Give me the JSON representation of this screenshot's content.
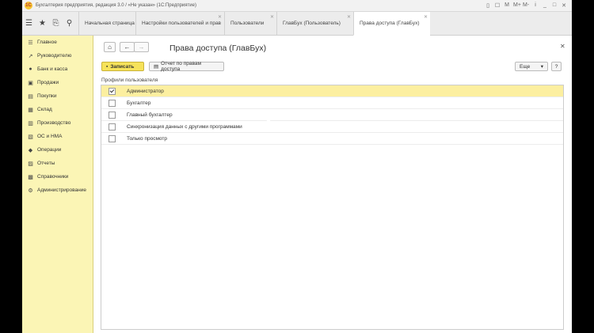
{
  "window": {
    "title": "Бухгалтерия предприятия, редакция 3.0 / «Не указан» (1С:Предприятие)",
    "controls": [
      "▯",
      "☐",
      "M",
      "M+",
      "M-",
      "i",
      "_",
      "□",
      "✕"
    ]
  },
  "tabs": [
    {
      "label": "Начальная страница",
      "closable": false
    },
    {
      "label": "Настройки пользователей и прав",
      "closable": true
    },
    {
      "label": "Пользователи",
      "closable": true
    },
    {
      "label": "ГлавБух (Пользователь)",
      "closable": true
    },
    {
      "label": "Права доступа (ГлавБух)",
      "closable": true,
      "active": true
    }
  ],
  "sidebar": {
    "items": [
      {
        "label": "Главное",
        "icon": "menu-icon"
      },
      {
        "label": "Руководителю",
        "icon": "chart-icon"
      },
      {
        "label": "Банк и касса",
        "icon": "bank-icon"
      },
      {
        "label": "Продажи",
        "icon": "sales-icon"
      },
      {
        "label": "Покупки",
        "icon": "purchases-icon"
      },
      {
        "label": "Склад",
        "icon": "warehouse-icon"
      },
      {
        "label": "Производство",
        "icon": "production-icon"
      },
      {
        "label": "ОС и НМА",
        "icon": "assets-icon"
      },
      {
        "label": "Операции",
        "icon": "operations-icon"
      },
      {
        "label": "Отчеты",
        "icon": "reports-icon"
      },
      {
        "label": "Справочники",
        "icon": "catalog-icon"
      },
      {
        "label": "Администрирование",
        "icon": "gear-icon"
      }
    ]
  },
  "form": {
    "title": "Права доступа (ГлавБух)",
    "save_label": "Записать",
    "report_label": "Отчет по правам доступа",
    "more_label": "Еще",
    "help_label": "?",
    "group_label": "Профили пользователя",
    "profiles": [
      {
        "name": "Администратор",
        "checked": true,
        "selected": true
      },
      {
        "name": "Бухгалтер",
        "checked": false
      },
      {
        "name": "Главный бухгалтер",
        "checked": false
      },
      {
        "name": "Синхронизация данных с другими программами",
        "checked": false
      },
      {
        "name": "Только просмотр",
        "checked": false
      }
    ]
  },
  "colors": {
    "sidebar_bg": "#fbf5b5",
    "primary_button": "#f6e25a",
    "selected_row": "#fcefa0"
  }
}
